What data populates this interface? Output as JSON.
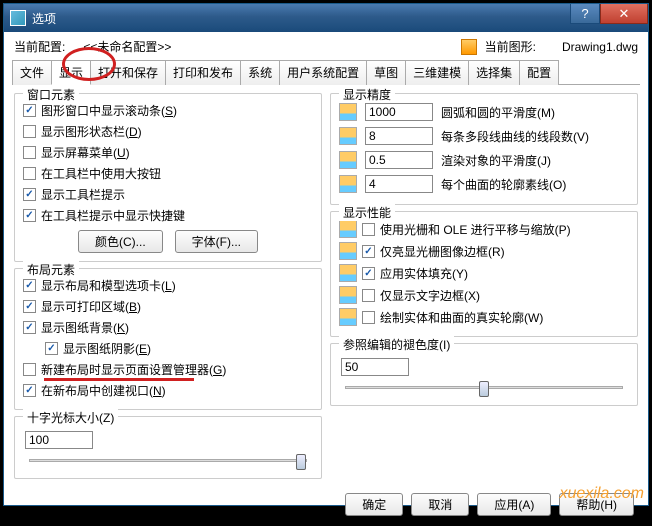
{
  "titlebar": {
    "title": "选项"
  },
  "header": {
    "current_profile_lbl": "当前配置:",
    "profile_name": "<<未命名配置>>",
    "current_drawing_lbl": "当前图形:",
    "drawing_name": "Drawing1.dwg"
  },
  "tabs": [
    "文件",
    "显示",
    "打开和保存",
    "打印和发布",
    "系统",
    "用户系统配置",
    "草图",
    "三维建模",
    "选择集",
    "配置"
  ],
  "active_tab_index": 1,
  "window_elements": {
    "title": "窗口元素",
    "items": [
      {
        "label": "图形窗口中显示滚动条(S)",
        "checked": true,
        "hot": "S"
      },
      {
        "label": "显示图形状态栏(D)",
        "checked": false,
        "hot": "D"
      },
      {
        "label": "显示屏幕菜单(U)",
        "checked": false,
        "hot": "U"
      },
      {
        "label": "在工具栏中使用大按钮",
        "checked": false
      },
      {
        "label": "显示工具栏提示",
        "checked": true
      },
      {
        "label": "在工具栏提示中显示快捷键",
        "checked": true
      }
    ],
    "btn_color": "颜色(C)...",
    "btn_font": "字体(F)..."
  },
  "layout_elements": {
    "title": "布局元素",
    "items": [
      {
        "label": "显示布局和模型选项卡(L)",
        "checked": true,
        "hot": "L"
      },
      {
        "label": "显示可打印区域(B)",
        "checked": true,
        "hot": "B"
      },
      {
        "label": "显示图纸背景(K)",
        "checked": true,
        "hot": "K"
      },
      {
        "label": "显示图纸阴影(E)",
        "checked": true,
        "hot": "E",
        "indent": true
      },
      {
        "label": "新建布局时显示页面设置管理器(G)",
        "checked": false,
        "hot": "G"
      },
      {
        "label": "在新布局中创建视口(N)",
        "checked": true,
        "hot": "N"
      }
    ]
  },
  "crosshair": {
    "title": "十字光标大小(Z)",
    "value": "100"
  },
  "precision": {
    "title": "显示精度",
    "rows": [
      {
        "val": "1000",
        "lbl": "圆弧和圆的平滑度(M)"
      },
      {
        "val": "8",
        "lbl": "每条多段线曲线的线段数(V)"
      },
      {
        "val": "0.5",
        "lbl": "渲染对象的平滑度(J)"
      },
      {
        "val": "4",
        "lbl": "每个曲面的轮廓素线(O)"
      }
    ]
  },
  "performance": {
    "title": "显示性能",
    "items": [
      {
        "label": "使用光栅和 OLE 进行平移与缩放(P)",
        "checked": false
      },
      {
        "label": "仅亮显光栅图像边框(R)",
        "checked": true
      },
      {
        "label": "应用实体填充(Y)",
        "checked": true
      },
      {
        "label": "仅显示文字边框(X)",
        "checked": false
      },
      {
        "label": "绘制实体和曲面的真实轮廓(W)",
        "checked": false
      }
    ]
  },
  "ref_edit": {
    "title": "参照编辑的褪色度(I)",
    "value": "50"
  },
  "buttons": {
    "ok": "确定",
    "cancel": "取消",
    "apply": "应用(A)",
    "help": "帮助(H)"
  },
  "watermark": "xuexila.com"
}
